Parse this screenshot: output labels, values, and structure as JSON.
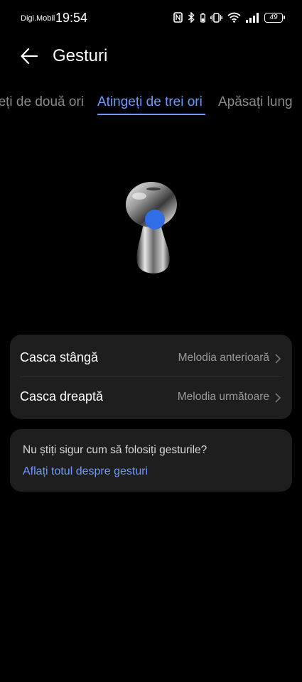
{
  "status_bar": {
    "carrier": "Digi.Mobil",
    "time": "19:54",
    "battery": "49",
    "icons": [
      "nfc-icon",
      "bluetooth-icon",
      "vibrate-icon",
      "wifi-icon",
      "signal-icon",
      "battery-icon"
    ]
  },
  "header": {
    "title": "Gesturi",
    "back_icon": "back-arrow-icon"
  },
  "tabs": {
    "prev": "Atingeți de două ori",
    "active": "Atingeți de trei ori",
    "next": "Apăsați lung"
  },
  "gestures": {
    "left_label": "Casca stângă",
    "left_value": "Melodia anterioară",
    "right_label": "Casca dreaptă",
    "right_value": "Melodia următoare"
  },
  "help": {
    "question": "Nu știți sigur cum să folosiți gesturile?",
    "link": "Aflați totul despre gesturi"
  },
  "colors": {
    "accent": "#6f98ff",
    "background": "#000000",
    "card": "#1e1e1e",
    "touch_point": "#2f6ee6"
  }
}
